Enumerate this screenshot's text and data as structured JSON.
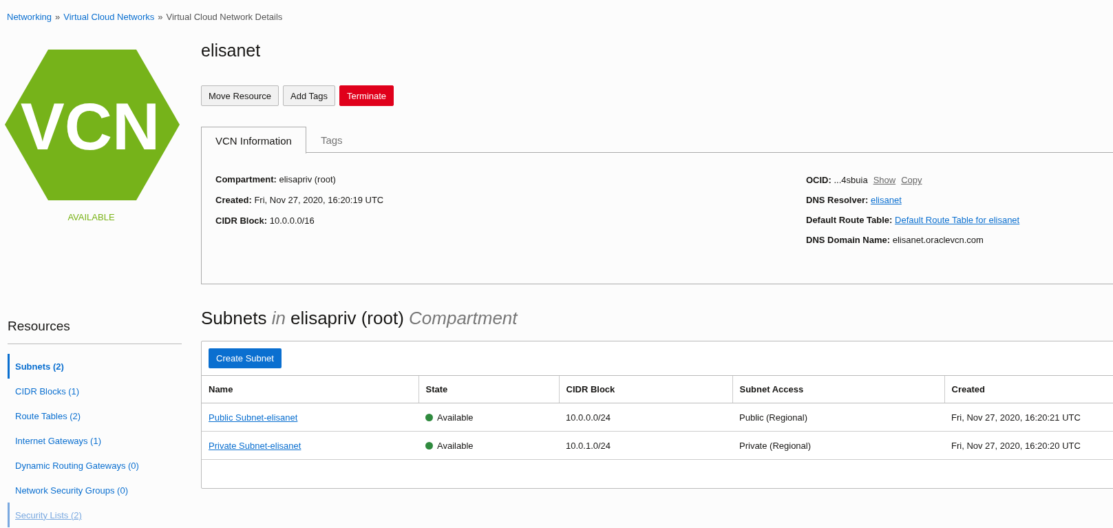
{
  "breadcrumb": [
    {
      "label": "Networking",
      "link": true
    },
    {
      "label": "Virtual Cloud Networks",
      "link": true
    },
    {
      "label": "Virtual Cloud Network Details",
      "link": false
    }
  ],
  "breadcrumb_separator": "»",
  "logo": {
    "text": "VCN",
    "status": "AVAILABLE"
  },
  "title": "elisanet",
  "actions": [
    {
      "label": "Move Resource",
      "kind": "default"
    },
    {
      "label": "Add Tags",
      "kind": "default"
    },
    {
      "label": "Terminate",
      "kind": "danger"
    }
  ],
  "tabs": [
    {
      "label": "VCN Information",
      "selected": true
    },
    {
      "label": "Tags",
      "selected": false
    }
  ],
  "info_left": [
    {
      "label": "Compartment:",
      "value": "elisapriv (root)"
    },
    {
      "label": "Created:",
      "value": "Fri, Nov 27, 2020, 16:20:19 UTC"
    },
    {
      "label": "CIDR Block:",
      "value": "10.0.0.0/16"
    }
  ],
  "info_right": [
    {
      "label": "OCID:",
      "value": "...4sbuia",
      "kind": "ocid",
      "actions": [
        "Show",
        "Copy"
      ]
    },
    {
      "label": "DNS Resolver:",
      "value": "elisanet",
      "kind": "link"
    },
    {
      "label": "Default Route Table:",
      "value": "Default Route Table for elisanet",
      "kind": "link"
    },
    {
      "label": "DNS Domain Name:",
      "value": "elisanet.oraclevcn.com",
      "kind": "text"
    }
  ],
  "sidebar": {
    "title": "Resources",
    "items": [
      {
        "label": "Subnets (2)",
        "selected": true,
        "hovered": false
      },
      {
        "label": "CIDR Blocks (1)",
        "selected": false,
        "hovered": false
      },
      {
        "label": "Route Tables (2)",
        "selected": false,
        "hovered": false
      },
      {
        "label": "Internet Gateways (1)",
        "selected": false,
        "hovered": false
      },
      {
        "label": "Dynamic Routing Gateways (0)",
        "selected": false,
        "hovered": false
      },
      {
        "label": "Network Security Groups (0)",
        "selected": false,
        "hovered": false
      },
      {
        "label": "Security Lists (2)",
        "selected": false,
        "hovered": true
      }
    ]
  },
  "subnets": {
    "heading": [
      "Subnets",
      "in",
      "elisapriv (root)",
      "Compartment"
    ],
    "create_button": "Create Subnet",
    "columns": [
      "Name",
      "State",
      "CIDR Block",
      "Subnet Access",
      "Created"
    ],
    "rows": [
      {
        "name": "Public Subnet-elisanet",
        "state": "Available",
        "color": "#2f8a3e",
        "cidr": "10.0.0.0/24",
        "access": "Public (Regional)",
        "created": "Fri, Nov 27, 2020, 16:20:21 UTC"
      },
      {
        "name": "Private Subnet-elisanet",
        "state": "Available",
        "color": "#2f8a3e",
        "cidr": "10.0.1.0/24",
        "access": "Private (Regional)",
        "created": "Fri, Nov 27, 2020, 16:20:20 UTC"
      }
    ]
  }
}
